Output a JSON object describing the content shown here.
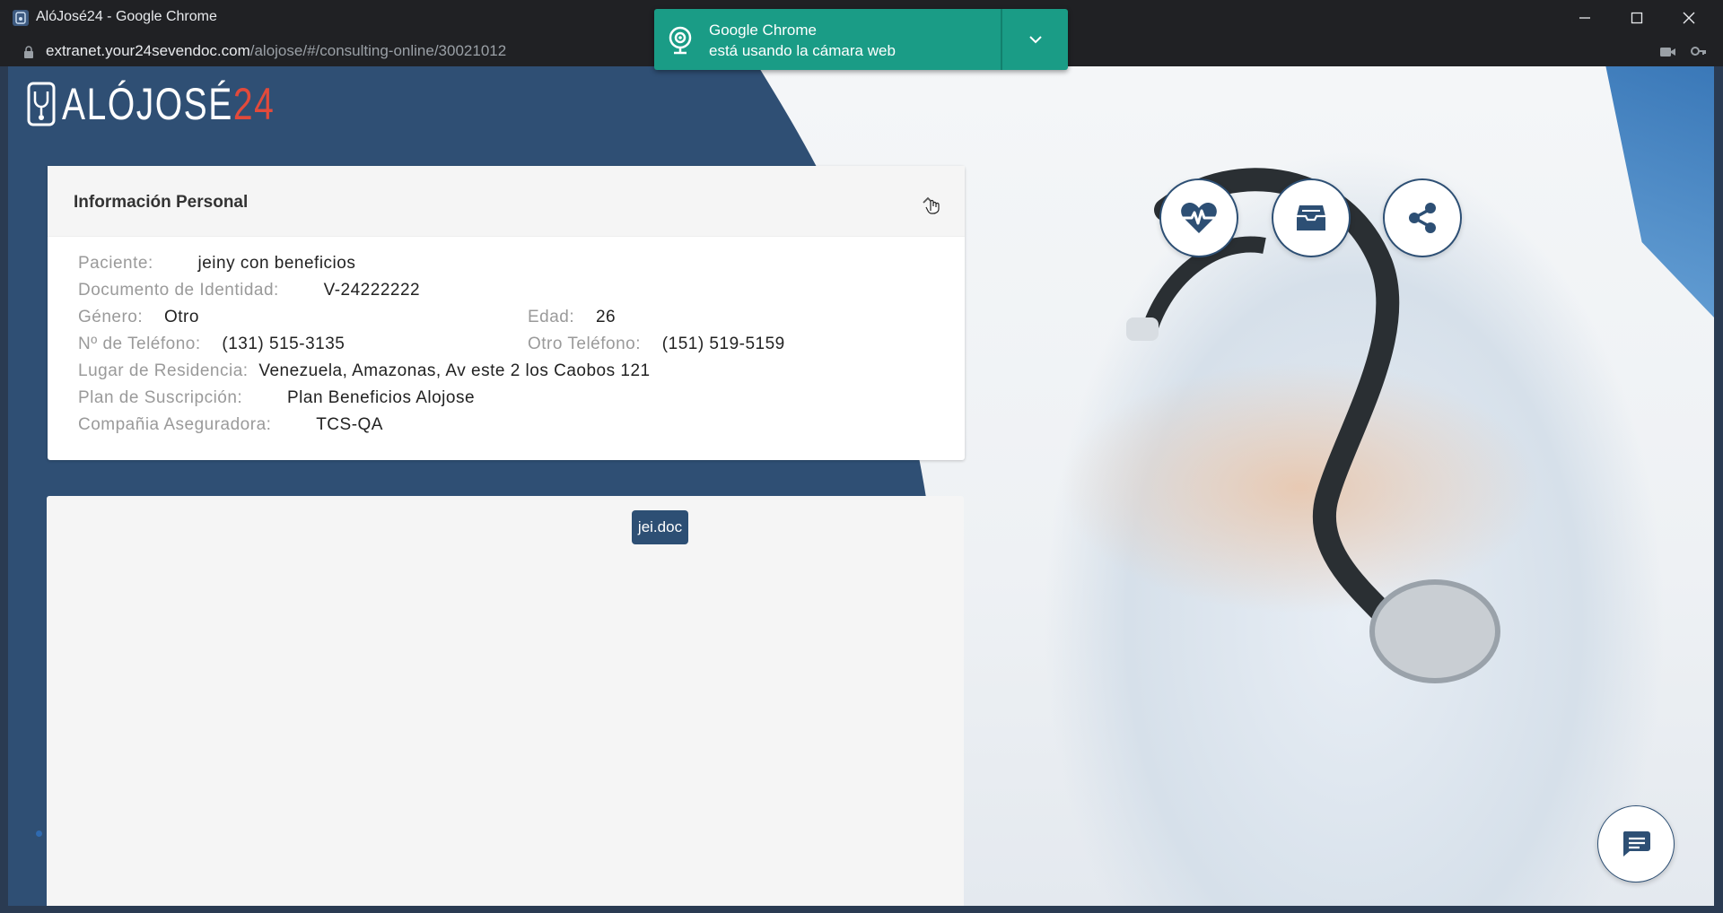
{
  "browser": {
    "window_title": "AlóJosé24 - Google Chrome",
    "url_host": "extranet.your24sevendoc.com",
    "url_path": "/alojose/#/consulting-online/30021012"
  },
  "notification": {
    "title": "Google Chrome",
    "message": "está usando la cámara web"
  },
  "logo": {
    "text_main": "ALÓJOSÉ",
    "text_num": "24"
  },
  "personal_info": {
    "title": "Información Personal",
    "fields": {
      "patient_label": "Paciente:",
      "patient_value": "jeiny con beneficios",
      "id_label": "Documento de Identidad:",
      "id_value": "V-24222222",
      "gender_label": "Género:",
      "gender_value": "Otro",
      "age_label": "Edad:",
      "age_value": "26",
      "phone_label": "Nº de Teléfono:",
      "phone_value": "(131) 515-3135",
      "other_phone_label": "Otro Teléfono:",
      "other_phone_value": "(151) 519-5159",
      "residence_label": "Lugar de Residencia:",
      "residence_value": "Venezuela, Amazonas, Av este 2 los Caobos 121",
      "plan_label": "Plan de Suscripción:",
      "plan_value": "Plan Beneficios Alojose",
      "insurer_label": "Compañia Aseguradora:",
      "insurer_value": "TCS-QA"
    }
  },
  "video_panel": {
    "participant_label": "jei.doc"
  },
  "actions": {
    "icons": [
      "heart-pulse-icon",
      "archive-icon",
      "share-icon",
      "chat-icon"
    ]
  },
  "colors": {
    "brand_blue": "#2d4f74",
    "accent_red": "#e24a3b",
    "notice_green": "#1a9c86"
  }
}
